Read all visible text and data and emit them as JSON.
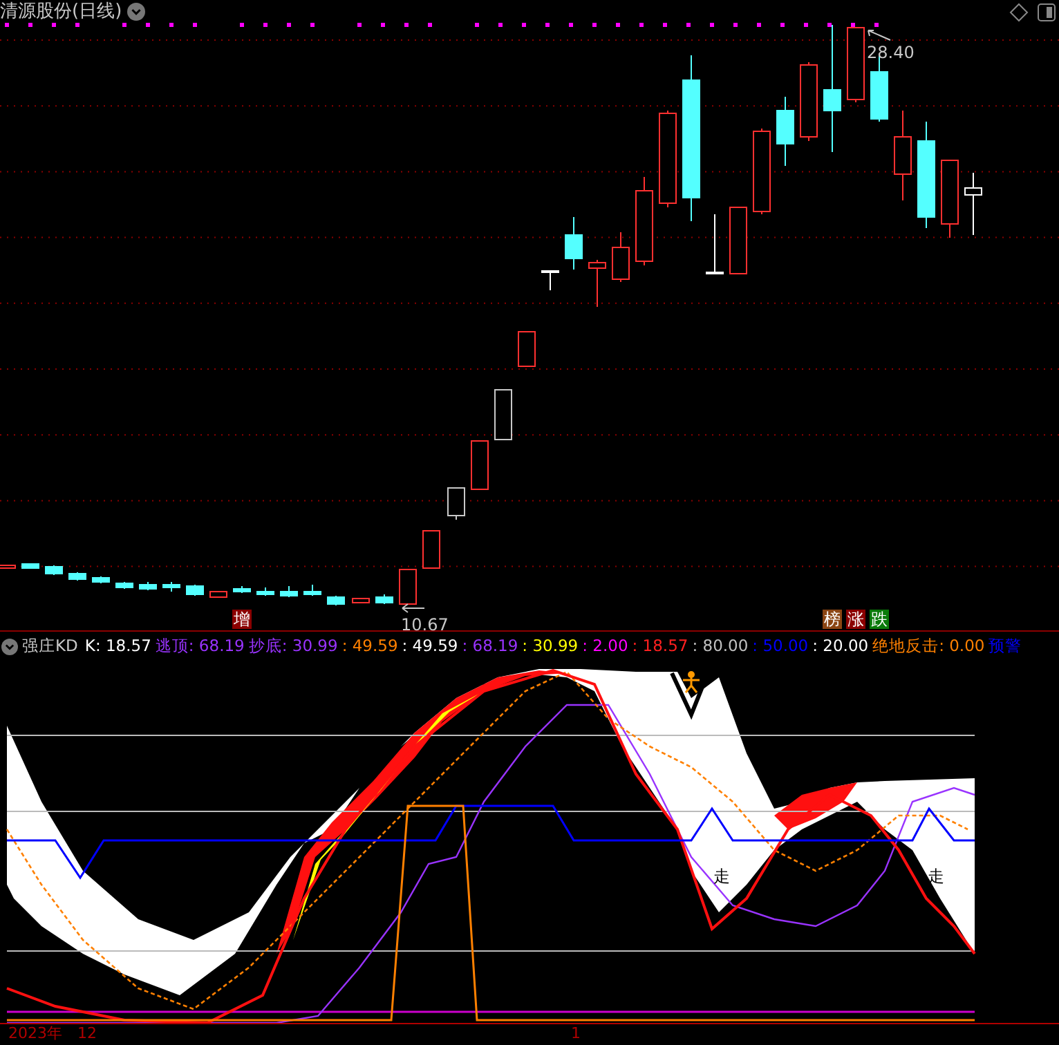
{
  "title": "清源股份(日线)",
  "price_labels": [
    {
      "kind": "high",
      "text": "28.40"
    },
    {
      "kind": "low",
      "text": "10.67"
    }
  ],
  "markers": [
    {
      "text": "增",
      "color": "#8b0000"
    },
    {
      "text": "榜",
      "color": "#8b4513"
    },
    {
      "text": "涨",
      "color": "#8b0000"
    },
    {
      "text": "跌",
      "color": "#0a7a0a"
    }
  ],
  "indicator": {
    "name": "强庄KD",
    "values": [
      {
        "text": "K: 18.57",
        "color": "#ffffff"
      },
      {
        "text": "逃顶: 68.19",
        "color": "#9933ff"
      },
      {
        "text": "抄底: 30.99",
        "color": "#9933ff"
      },
      {
        "text": ": 49.59",
        "color": "#ff8000"
      },
      {
        "text": ": 49.59",
        "color": "#ffffff"
      },
      {
        "text": ": 68.19",
        "color": "#9933ff"
      },
      {
        "text": ": 30.99",
        "color": "#ffff00"
      },
      {
        "text": ": 2.00",
        "color": "#ff00ff"
      },
      {
        "text": ": 18.57",
        "color": "#ff2020"
      },
      {
        "text": ": 80.00",
        "color": "#c0c0c0"
      },
      {
        "text": ": 50.00",
        "color": "#0000ff"
      },
      {
        "text": ": 20.00",
        "color": "#ffffff"
      },
      {
        "text": "绝地反击: 0.00",
        "color": "#ff8000"
      },
      {
        "text": "预警",
        "color": "#0000ff"
      }
    ],
    "chart_labels": [
      "走",
      "走"
    ]
  },
  "date_axis": [
    "2023年",
    "12",
    "1"
  ]
}
